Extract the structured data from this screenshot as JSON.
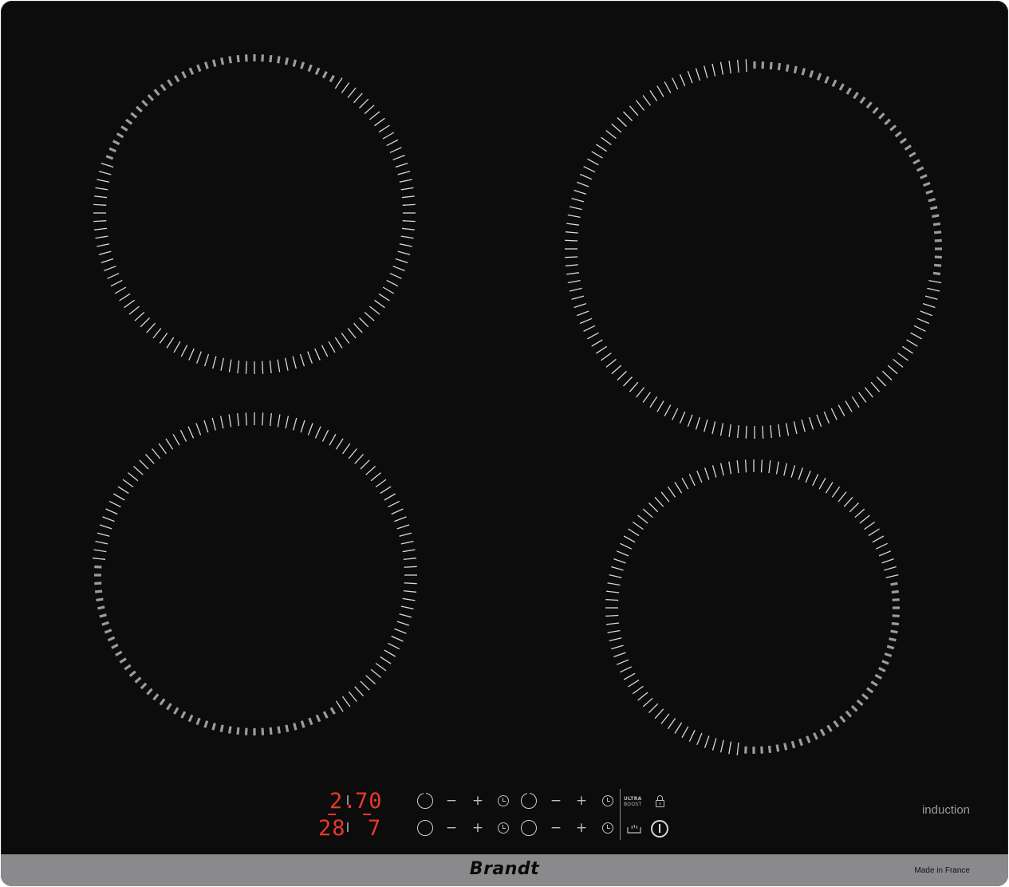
{
  "brand": {
    "name": "Brandt",
    "made_in": "Made in France",
    "technology_label": "induction"
  },
  "zones": [
    {
      "id": "front-left-top",
      "name": "rear-left"
    },
    {
      "id": "rear-right",
      "name": "rear-right"
    },
    {
      "id": "front-left",
      "name": "front-left"
    },
    {
      "id": "front-right",
      "name": "front-right"
    }
  ],
  "display": {
    "top_left_value": "2.",
    "top_right_value": "70",
    "bottom_left_value": "28",
    "bottom_right_value": "7"
  },
  "controls": {
    "minus": "−",
    "plus": "+",
    "boost_label_line1": "ULTRA",
    "boost_label_line2": "BOOST"
  },
  "colors": {
    "glass": "#0c0c0d",
    "tick": "#d9d9d9",
    "tick_lit": "#9c9c9c",
    "display": "#e8392a",
    "strip": "#8a8a8d"
  }
}
